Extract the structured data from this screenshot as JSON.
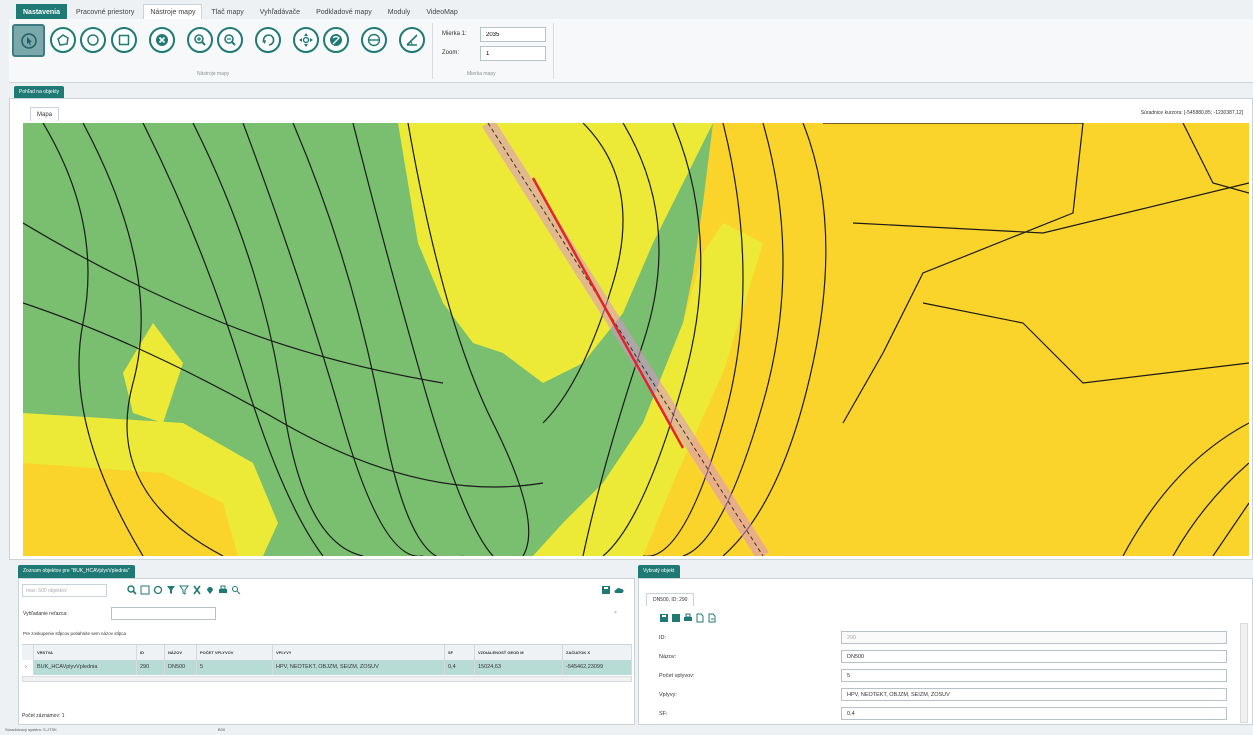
{
  "ribbon": {
    "tabs": [
      "Nastavenia",
      "Pracovné priestory",
      "Nástroje mapy",
      "Tlač mapy",
      "Vyhľadávače",
      "Podkladové mapy",
      "Moduly",
      "VideoMap"
    ],
    "active_tab": "Nástroje mapy",
    "map_tools_group_label": "Nástroje mapy",
    "scale_group_label": "Mierka mapy",
    "scale_label": "Mierka 1:",
    "scale_value": "2035",
    "zoom_label": "Zoom:",
    "zoom_value": "1",
    "tool_icons": [
      "pointer-icon",
      "polygon-select-icon",
      "circle-select-icon",
      "rectangle-select-icon",
      "clear-selection-icon",
      "zoom-in-icon",
      "zoom-out-icon",
      "rotate-icon",
      "pan-icon",
      "full-extent-icon",
      "measure-distance-icon",
      "measure-angle-icon"
    ]
  },
  "map_view": {
    "panel_title": "Pohľad na objekty",
    "tab_label": "Mapa",
    "cursor_coords": "Súradnice kurzora: [-545880,85; -1230387,12]",
    "colors": {
      "green": "#79bf6f",
      "yellow_light": "#ecea36",
      "yellow": "#fbd42b",
      "route": "#e3252a",
      "buffer": "#d88fd3"
    }
  },
  "object_list": {
    "title": "Zoznam objektov pre \"BUK_HCAVplyvVplednia\"",
    "limit_placeholder": "max. 500 objektov",
    "search_label": "Vyhľadanie reťazca:",
    "group_hint": "Pre zoskupenie stĺpcov potiahnite sem názov stĺpca",
    "columns": [
      "VRSTVA",
      "ID",
      "NÁZOV",
      "POČET VPLYVOV",
      "VPLYVY",
      "SF",
      "VZDIALENOSŤ GEOD M",
      "ZAČIATOK X"
    ],
    "rows": [
      [
        "BUK_HCAVplyvVplednia",
        "290",
        "DN500",
        "5",
        "HPV, NEOTEKT, OBJZM, SEIZM, ZOSUV",
        "0,4",
        "15024,63",
        "-545462,23099"
      ]
    ],
    "row_count": "Počet záznamov: 1"
  },
  "details": {
    "title": "Vybratý objekt",
    "object_tab": "DN500, ID: 290",
    "fields": [
      {
        "label": "ID:",
        "value": "290"
      },
      {
        "label": "Názov:",
        "value": "DN500"
      },
      {
        "label": "Počet vplyvov:",
        "value": "5"
      },
      {
        "label": "Vplyvy:",
        "value": "HPV, NEOTEKT, OBJZM, SEIZM, ZOSUV"
      },
      {
        "label": "SF:",
        "value": "0,4"
      }
    ]
  },
  "statusbar": {
    "text": "Súradnicový systém: S-JTSK",
    "scale": "B00"
  }
}
